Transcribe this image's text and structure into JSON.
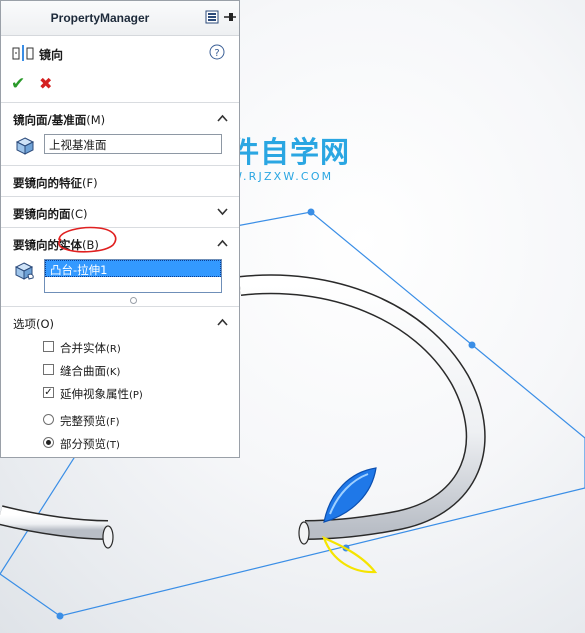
{
  "panel": {
    "title": "PropertyManager",
    "feature_name": "镜向",
    "groups": {
      "mirror_face": {
        "label": "镜向面/基准面",
        "key": "(M)",
        "value": "上视基准面"
      },
      "features": {
        "label": "要镜向的特征",
        "key": "(F)"
      },
      "faces": {
        "label": "要镜向的面",
        "key": "(C)"
      },
      "bodies": {
        "label": "要镜向的实体",
        "key": "(B)",
        "items": [
          "凸台-拉伸1"
        ]
      },
      "options": {
        "label": "选项",
        "key": "(O)",
        "checkboxes": [
          {
            "label": "合并实体",
            "key": "(R)",
            "checked": false
          },
          {
            "label": "缝合曲面",
            "key": "(K)",
            "checked": false
          },
          {
            "label": "延伸视象属性",
            "key": "(P)",
            "checked": true
          }
        ],
        "radios": [
          {
            "label": "完整预览",
            "key": "(F)",
            "selected": false
          },
          {
            "label": "部分预览",
            "key": "(T)",
            "selected": true
          }
        ]
      }
    }
  },
  "watermark": {
    "title": "软件自学网",
    "url": "WWW.RJZXW.COM"
  },
  "colors": {
    "plane": "#3a8ee6",
    "annotation": "#e02020",
    "handle_blue": "#1f78e8",
    "handle_yellow": "#f5e400"
  },
  "icons": [
    "pin-icon",
    "config-icon",
    "mirror-feature-icon",
    "help-icon",
    "check-icon",
    "cancel-icon",
    "chevron-up-icon",
    "chevron-down-icon",
    "cube-icon",
    "body-icon"
  ]
}
